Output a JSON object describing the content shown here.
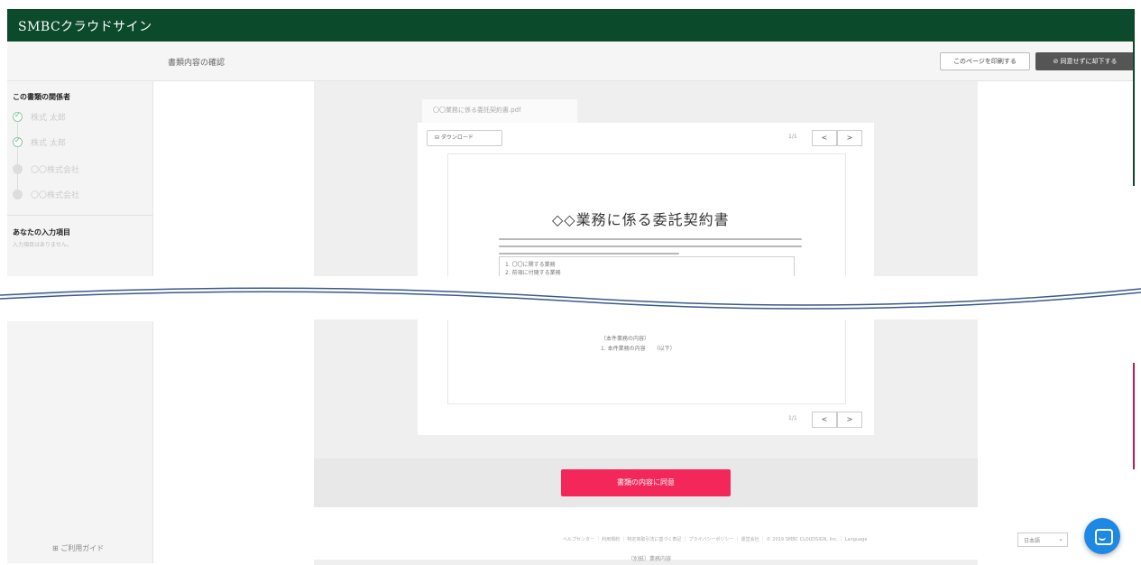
{
  "app": {
    "logo": "SMBCクラウドサイン"
  },
  "subbar": {
    "title": "書類内容の確認",
    "note_button": "このページを印刷する",
    "decline_button": "⊘ 同意せずに却下する"
  },
  "sidebar": {
    "parties_heading": "この書類の関係者",
    "parties": [
      {
        "name": "株式 太郎",
        "status": "done"
      },
      {
        "name": "株式 太郎",
        "status": "done"
      },
      {
        "name": "〇〇株式会社",
        "status": "pending"
      },
      {
        "name": "〇〇株式会社",
        "status": "pending"
      }
    ],
    "input_heading": "あなたの入力項目",
    "input_sub": "入力項目はありません。",
    "guide_link": "⊞ ご利用ガイド"
  },
  "document": {
    "tab_label": "〇〇業務に係る委託契約書.pdf",
    "download_button": "⊟ ダウンロード",
    "page_indicator": "1/1",
    "prev": "<",
    "next": ">",
    "contract_title": "◇◇業務に係る委託契約書",
    "clause_lines": [
      "1. 〇〇に関する業務",
      "2. 前項に付随する業務"
    ],
    "lower_lines": [
      "（本件業務の内容）",
      "1. 本件業務の内容　　（以下）"
    ]
  },
  "cta": {
    "agree_button": "書類の内容に同意"
  },
  "footer": {
    "links": "ヘルプセンター ｜ 利用規約 ｜ 特定商取引法に基づく表記 ｜ プライバシーポリシー ｜ 運営会社 ｜ © 2019 SMBC CLOUDSIGN, Inc. ｜ Language",
    "language": "日本語",
    "bottom_text": "（別紙）業務内容"
  },
  "colors": {
    "header": "#0c4a2c",
    "agree": "#f4275a",
    "chat": "#1e88e5"
  }
}
